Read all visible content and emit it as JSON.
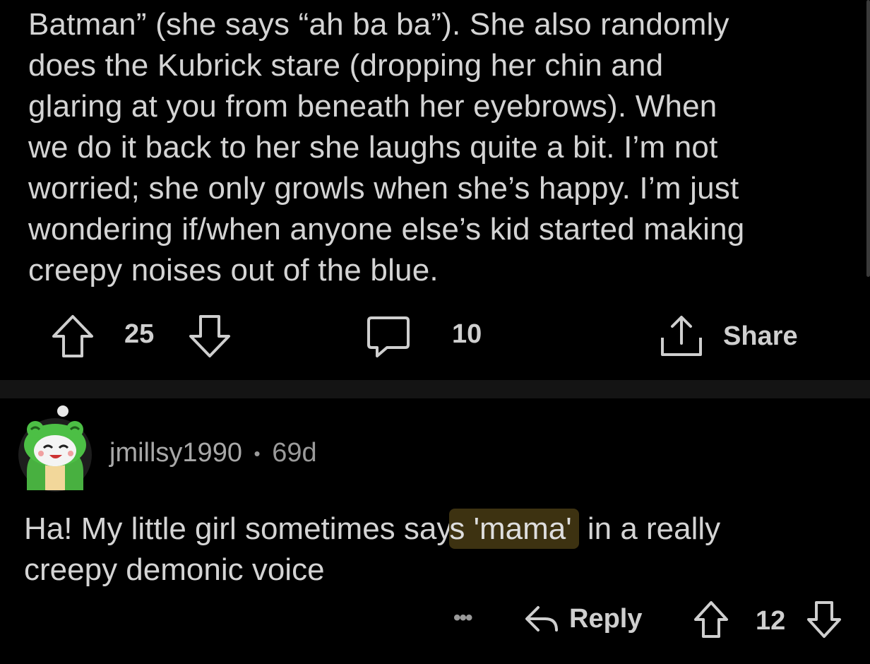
{
  "post": {
    "body_lines": [
      "Batman” (she says “ah ba ba”). She also randomly",
      "does the Kubrick stare (dropping her chin and",
      "glaring at you from beneath her eyebrows). When",
      "we do it back to her she laughs quite a bit. I’m not",
      "worried; she only growls when she’s happy. I’m just",
      "wondering if/when anyone else’s kid started making",
      "creepy noises out of the blue."
    ],
    "vote_count": "25",
    "comment_count": "10",
    "share_label": "Share"
  },
  "comment": {
    "username": "jmillsy1990",
    "separator": "•",
    "age": "69d",
    "text_before": "Ha! My little girl sometimes say",
    "text_mid": "s ",
    "highlight": "'mama'",
    "text_after": " in a really",
    "line2": "creepy demonic voice",
    "more_label": "•••",
    "reply_label": "Reply",
    "vote_count": "12"
  },
  "colors": {
    "background": "#000000",
    "text": "#d4d4d4",
    "divider": "#141414",
    "highlight": "#3d3211"
  }
}
